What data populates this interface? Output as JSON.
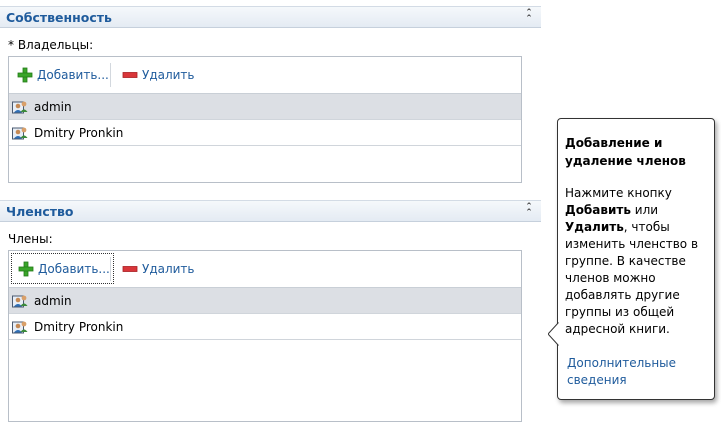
{
  "ownership": {
    "title": "Собственность",
    "owners_label": "* Владельцы:",
    "add_label": "Добавить...",
    "remove_label": "Удалить",
    "rows": [
      {
        "name": "admin"
      },
      {
        "name": "Dmitry Pronkin"
      }
    ]
  },
  "membership": {
    "title": "Членство",
    "members_label": "Члены:",
    "add_label": "Добавить...",
    "remove_label": "Удалить",
    "rows": [
      {
        "name": "admin"
      },
      {
        "name": "Dmitry Pronkin"
      }
    ]
  },
  "tooltip": {
    "title": "Добавление и удаление членов",
    "body_pre": "Нажмите кнопку ",
    "body_b1": "Добавить",
    "body_mid": " или ",
    "body_b2": "Удалить",
    "body_post": ", чтобы изменить членство в группе. В качестве членов можно добавлять другие группы из общей адресной книги.",
    "link": "Дополнительные сведения"
  },
  "colors": {
    "accent": "#1f5b9c",
    "selected_row": "#dcdfe4",
    "add_icon": "#3aa52a",
    "remove_icon": "#d9363a"
  },
  "icons": {
    "add": "plus-icon",
    "remove": "minus-icon",
    "user": "user-icon",
    "collapse": "double-chevron-up-icon"
  }
}
